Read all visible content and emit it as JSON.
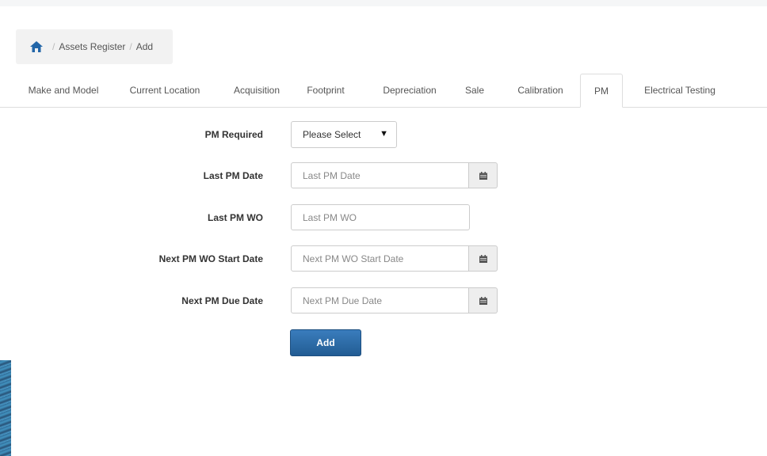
{
  "breadcrumb": {
    "items": [
      "Assets Register",
      "Add"
    ],
    "home_icon": "home-icon"
  },
  "tabs": [
    {
      "label": "Make and Model",
      "active": false
    },
    {
      "label": "Current Location",
      "active": false
    },
    {
      "label": "Acquisition",
      "active": false
    },
    {
      "label": "Footprint",
      "active": false
    },
    {
      "label": "Depreciation",
      "active": false
    },
    {
      "label": "Sale",
      "active": false
    },
    {
      "label": "Calibration",
      "active": false
    },
    {
      "label": "PM",
      "active": true
    },
    {
      "label": "Electrical Testing",
      "active": false
    }
  ],
  "form": {
    "pm_required": {
      "label": "PM Required",
      "selected": "Please Select"
    },
    "last_pm_date": {
      "label": "Last PM Date",
      "placeholder": "Last PM Date",
      "icon": "calendar-icon"
    },
    "last_pm_wo": {
      "label": "Last PM WO",
      "placeholder": "Last PM WO"
    },
    "next_pm_wo_start_date": {
      "label": "Next PM WO Start Date",
      "placeholder": "Next PM WO Start Date",
      "icon": "calendar-icon"
    },
    "next_pm_due_date": {
      "label": "Next PM Due Date",
      "placeholder": "Next PM Due Date",
      "icon": "calendar-icon"
    },
    "add_button": "Add"
  },
  "colors": {
    "primary": "#2b6ba6",
    "addon_bg": "#eeeeee",
    "breadcrumb_bg": "#f2f2f2"
  }
}
